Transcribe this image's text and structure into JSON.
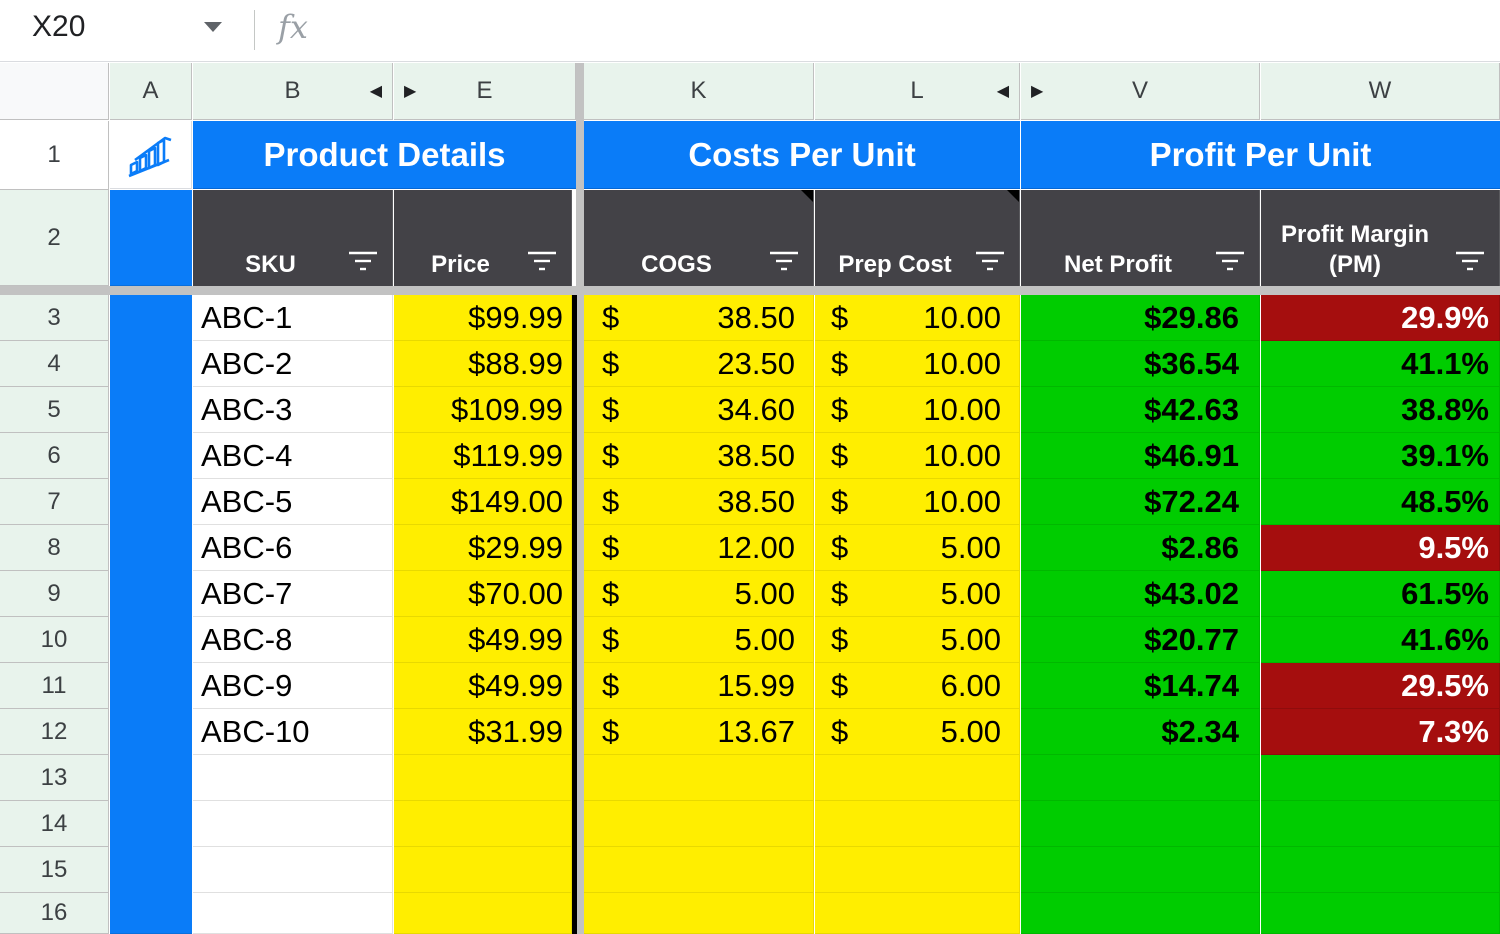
{
  "formula_bar": {
    "name_box": "X20",
    "fx_icon": "fx"
  },
  "columns": [
    "A",
    "B",
    "E",
    "K",
    "L",
    "V",
    "W"
  ],
  "rows": [
    "1",
    "2",
    "3",
    "4",
    "5",
    "6",
    "7",
    "8",
    "9",
    "10",
    "11",
    "12",
    "13",
    "14",
    "15",
    "16"
  ],
  "groups": {
    "product_details": "Product Details",
    "costs_per_unit": "Costs Per Unit",
    "profit_per_unit": "Profit Per Unit"
  },
  "headers": {
    "sku": "SKU",
    "price": "Price",
    "cogs": "COGS",
    "prep_cost": "Prep Cost",
    "net_profit": "Net Profit",
    "profit_margin": "Profit Margin (PM)"
  },
  "currency_symbol": "$",
  "table": [
    {
      "sku": "ABC-1",
      "price": "$99.99",
      "cogs": "38.50",
      "prep": "10.00",
      "net": "$29.86",
      "pm": "29.9%",
      "pm_status": "bad"
    },
    {
      "sku": "ABC-2",
      "price": "$88.99",
      "cogs": "23.50",
      "prep": "10.00",
      "net": "$36.54",
      "pm": "41.1%",
      "pm_status": "good"
    },
    {
      "sku": "ABC-3",
      "price": "$109.99",
      "cogs": "34.60",
      "prep": "10.00",
      "net": "$42.63",
      "pm": "38.8%",
      "pm_status": "good"
    },
    {
      "sku": "ABC-4",
      "price": "$119.99",
      "cogs": "38.50",
      "prep": "10.00",
      "net": "$46.91",
      "pm": "39.1%",
      "pm_status": "good"
    },
    {
      "sku": "ABC-5",
      "price": "$149.00",
      "cogs": "38.50",
      "prep": "10.00",
      "net": "$72.24",
      "pm": "48.5%",
      "pm_status": "good"
    },
    {
      "sku": "ABC-6",
      "price": "$29.99",
      "cogs": "12.00",
      "prep": "5.00",
      "net": "$2.86",
      "pm": "9.5%",
      "pm_status": "bad"
    },
    {
      "sku": "ABC-7",
      "price": "$70.00",
      "cogs": "5.00",
      "prep": "5.00",
      "net": "$43.02",
      "pm": "61.5%",
      "pm_status": "good"
    },
    {
      "sku": "ABC-8",
      "price": "$49.99",
      "cogs": "5.00",
      "prep": "5.00",
      "net": "$20.77",
      "pm": "41.6%",
      "pm_status": "good"
    },
    {
      "sku": "ABC-9",
      "price": "$49.99",
      "cogs": "15.99",
      "prep": "6.00",
      "net": "$14.74",
      "pm": "29.5%",
      "pm_status": "bad"
    },
    {
      "sku": "ABC-10",
      "price": "$31.99",
      "cogs": "13.67",
      "prep": "5.00",
      "net": "$2.34",
      "pm": "7.3%",
      "pm_status": "bad"
    }
  ],
  "colors": {
    "header_blue": "#0a7cf8",
    "subheader_dark": "#434247",
    "cost_yellow": "#ffee00",
    "profit_green": "#00cc00",
    "margin_red": "#a50e0e"
  },
  "icons": [
    "chevron-down-icon",
    "fx-icon",
    "filter-icon",
    "bar-chart-logo-icon",
    "column-arrow-left-icon",
    "column-arrow-right-icon"
  ]
}
